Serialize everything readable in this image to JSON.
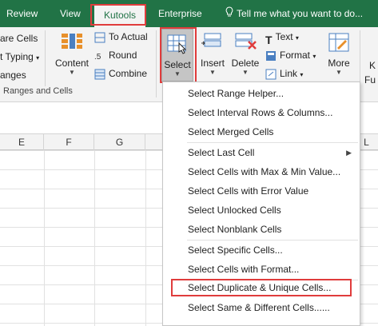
{
  "tabs": {
    "review": "Review",
    "view": "View",
    "kutools": "Kutools",
    "enterprise": "Enterprise",
    "tell_me": "Tell me what you want to do..."
  },
  "ribbon": {
    "left_items": [
      "are Cells",
      "t Typing",
      "anges"
    ],
    "content_label": "Content",
    "to_actual": "To Actual",
    "round": "Round",
    "combine": "Combine",
    "group_label": "Ranges and Cells",
    "select_label": "Select",
    "insert_label": "Insert",
    "delete_label": "Delete",
    "text_label": "Text",
    "format_label": "Format",
    "link_label": "Link",
    "more_label": "More",
    "right_edge_top": "K",
    "right_edge_bottom": "Fu"
  },
  "columns": [
    "E",
    "F",
    "G",
    "L"
  ],
  "menu": {
    "items": [
      "Select Range Helper...",
      "Select Interval Rows & Columns...",
      "Select Merged Cells",
      "Select Last Cell",
      "Select Cells with Max & Min Value...",
      "Select Cells with Error Value",
      "Select Unlocked Cells",
      "Select Nonblank Cells",
      "Select Specific Cells...",
      "Select Cells with Format...",
      "Select Duplicate & Unique Cells...",
      "Select Same & Different Cells......"
    ]
  },
  "colors": {
    "ribbon_green": "#217346",
    "highlight_red": "#e03c3c"
  }
}
